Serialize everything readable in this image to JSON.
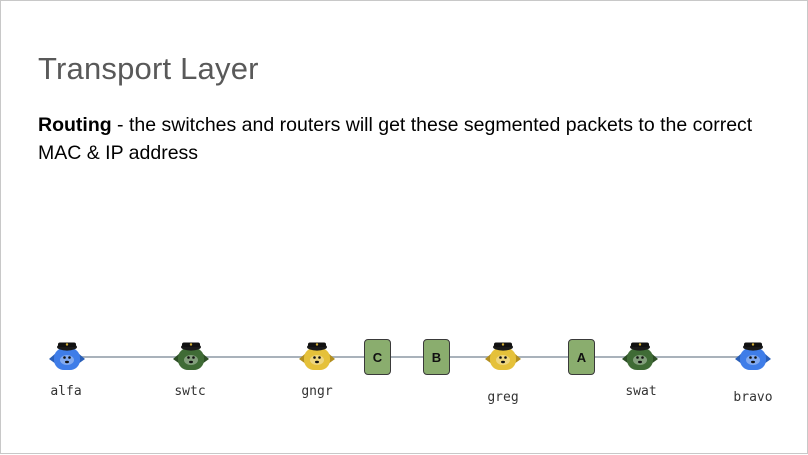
{
  "slide": {
    "title": "Transport Layer",
    "body_bold": "Routing",
    "body_rest": " - the switches and routers will get these segmented packets to the correct MAC & IP address"
  },
  "network": {
    "nodes": [
      {
        "label": "alfa",
        "color": "#3f7de8",
        "icon": "blue-pod-icon"
      },
      {
        "label": "swtc",
        "color": "#3f6b35",
        "icon": "green-pod-icon"
      },
      {
        "label": "gngr",
        "color": "#e5c13a",
        "icon": "yellow-pod-icon"
      },
      {
        "label": "greg",
        "color": "#e5c13a",
        "icon": "yellow-pod-icon"
      },
      {
        "label": "swat",
        "color": "#3f6b35",
        "icon": "green-pod-icon"
      },
      {
        "label": "bravo",
        "color": "#3f7de8",
        "icon": "blue-pod-icon"
      }
    ],
    "packets": [
      "C",
      "B",
      "A"
    ],
    "packet_color": "#8aad6e",
    "wire_color": "#a9b2bb"
  }
}
